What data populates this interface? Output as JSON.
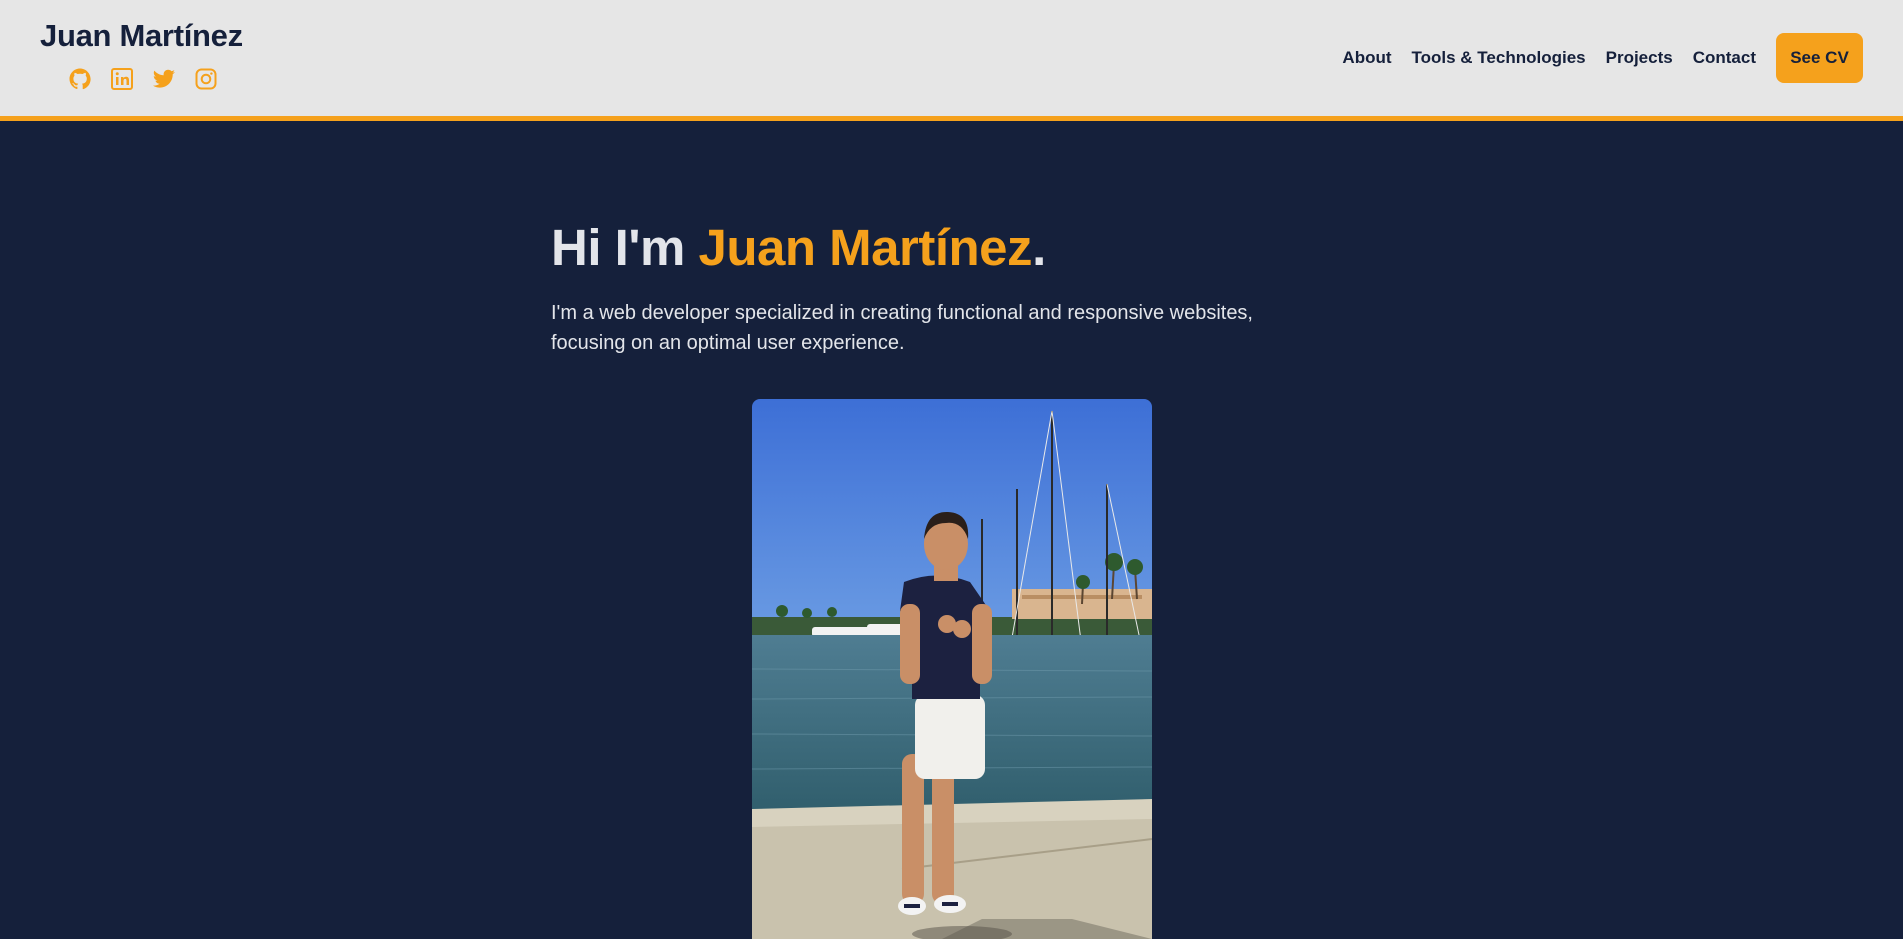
{
  "header": {
    "brand": "Juan Martínez",
    "socials": [
      {
        "icon": "github-icon"
      },
      {
        "icon": "linkedin-icon"
      },
      {
        "icon": "twitter-icon"
      },
      {
        "icon": "instagram-icon"
      }
    ],
    "nav": {
      "about": "About",
      "tools": "Tools & Technologies",
      "projects": "Projects",
      "contact": "Contact"
    },
    "cv_button": "See CV"
  },
  "hero": {
    "greeting": "Hi I'm ",
    "name": "Juan Martínez",
    "period": ".",
    "description": "I'm a web developer specialized in creating functional and responsive websites, focusing on an optimal user experience."
  },
  "colors": {
    "accent": "#f5a11c",
    "background": "#15203b",
    "header_bg": "#e6e6e6",
    "text_light": "#e3e5ea",
    "text_dark": "#15203b"
  }
}
